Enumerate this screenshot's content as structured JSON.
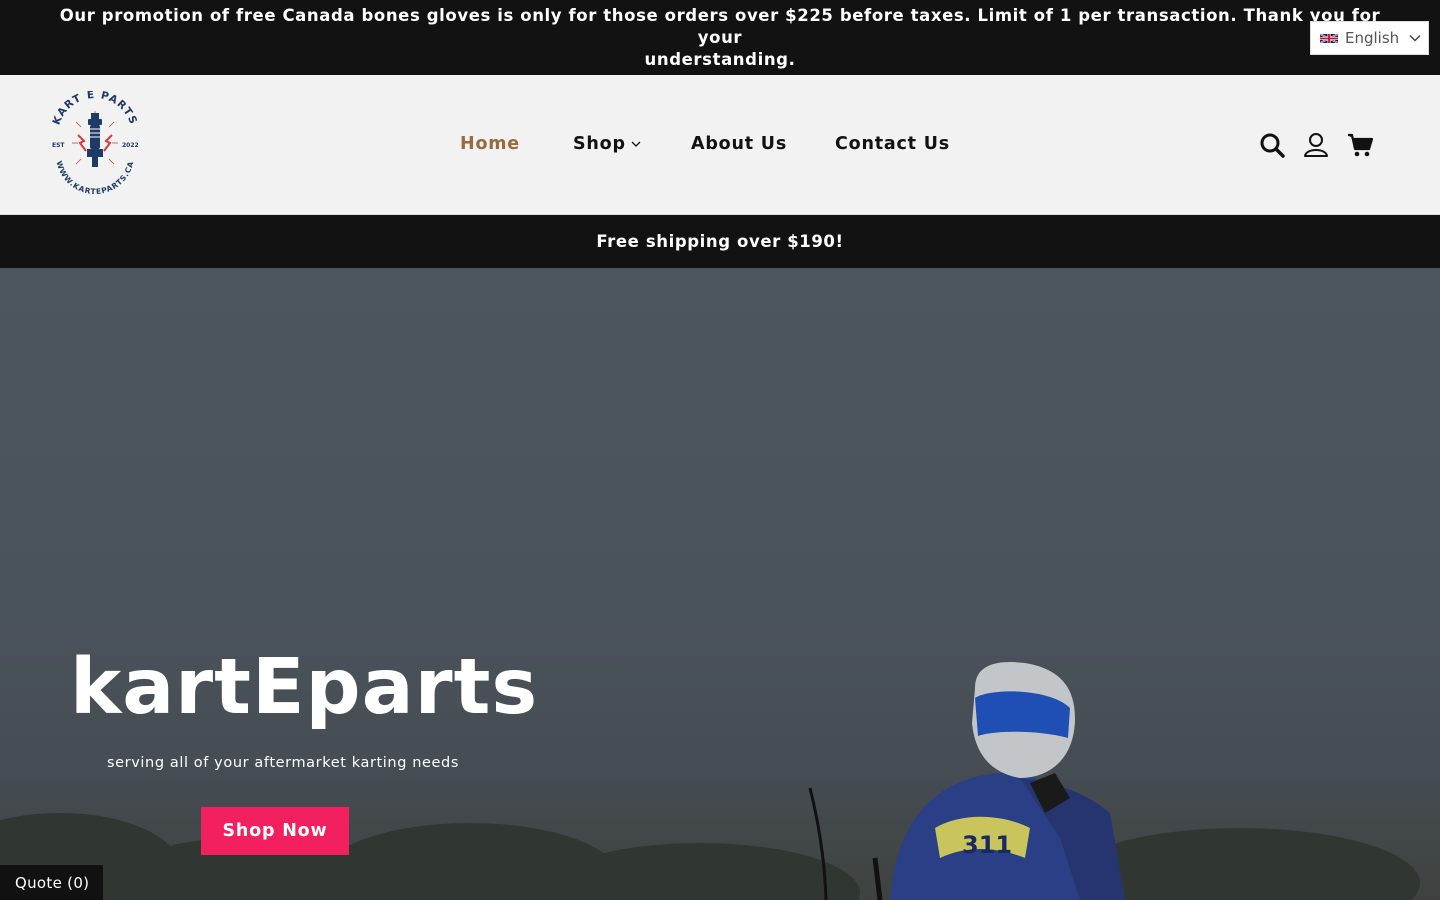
{
  "announcement": {
    "text": "Our promotion of free Canada bones gloves is only for those orders over $225 before taxes. Limit of 1 per transaction. Thank you for your\nunderstanding."
  },
  "language": {
    "selected": "English",
    "flag_icon": "uk-flag-icon"
  },
  "logo": {
    "top_text": "KART E PARTS",
    "left_text": "EST",
    "right_text": "2022",
    "bottom_text": "WWW.KARTEPARTS.CA",
    "accent_color": "#d93a3a",
    "brand_color": "#1e3a66"
  },
  "nav": {
    "items": [
      {
        "label": "Home",
        "active": true
      },
      {
        "label": "Shop",
        "has_dropdown": true
      },
      {
        "label": "About Us"
      },
      {
        "label": "Contact Us"
      }
    ],
    "active_color": "#9a6a3e"
  },
  "header_icons": [
    "search-icon",
    "account-icon",
    "cart-icon"
  ],
  "shipping_bar": {
    "text": "Free shipping over $190!"
  },
  "hero": {
    "title": "kartEparts",
    "subtitle": "serving all of your aftermarket karting needs",
    "button_label": "Shop Now",
    "button_color": "#f3205f",
    "kart_number": "311"
  },
  "quote_widget": {
    "label": "Quote (0)"
  }
}
